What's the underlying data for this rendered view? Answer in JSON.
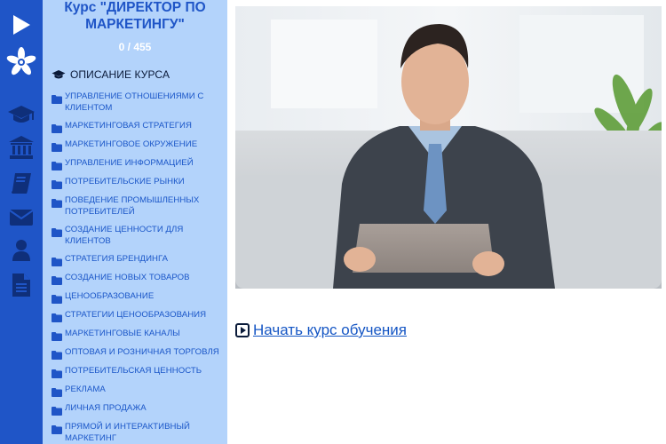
{
  "course": {
    "title": "Курс \"ДИРЕКТОР ПО МАРКЕТИНГУ\"",
    "progress": "0 / 455"
  },
  "menu": {
    "description_label": "ОПИСАНИЕ КУРСА",
    "items": [
      {
        "label": "УПРАВЛЕНИЕ ОТНОШЕНИЯМИ С КЛИЕНТОМ"
      },
      {
        "label": "МАРКЕТИНГОВАЯ СТРАТЕГИЯ"
      },
      {
        "label": "МАРКЕТИНГОВОЕ ОКРУЖЕНИЕ"
      },
      {
        "label": "УПРАВЛЕНИЕ ИНФОРМАЦИЕЙ"
      },
      {
        "label": "ПОТРЕБИТЕЛЬСКИЕ РЫНКИ"
      },
      {
        "label": "ПОВЕДЕНИЕ ПРОМЫШЛЕННЫХ ПОТРЕБИТЕЛЕЙ"
      },
      {
        "label": "СОЗДАНИЕ ЦЕННОСТИ ДЛЯ КЛИЕНТОВ"
      },
      {
        "label": "СТРАТЕГИЯ БРЕНДИНГА"
      },
      {
        "label": "СОЗДАНИЕ НОВЫХ ТОВАРОВ"
      },
      {
        "label": "ЦЕНООБРАЗОВАНИЕ"
      },
      {
        "label": "СТРАТЕГИИ ЦЕНООБРАЗОВАНИЯ"
      },
      {
        "label": "МАРКЕТИНГОВЫЕ КАНАЛЫ"
      },
      {
        "label": "ОПТОВАЯ И РОЗНИЧНАЯ ТОРГОВЛЯ"
      },
      {
        "label": "ПОТРЕБИТЕЛЬСКАЯ ЦЕННОСТЬ"
      },
      {
        "label": "РЕКЛАМА"
      },
      {
        "label": "ЛИЧНАЯ ПРОДАЖА"
      },
      {
        "label": "ПРЯМОЙ И ИНТЕРАКТИВНЫЙ МАРКЕТИНГ"
      }
    ]
  },
  "rail": {
    "icons": [
      "play-icon",
      "logo-icon",
      "graduation-cap-icon",
      "institution-icon",
      "book-icon",
      "envelope-icon",
      "user-icon",
      "document-icon"
    ]
  },
  "main": {
    "start_label": "Начать курс обучения"
  },
  "colors": {
    "rail": "#1f55c7",
    "menu_bg": "#b3d3fb",
    "link": "#1556c4"
  }
}
